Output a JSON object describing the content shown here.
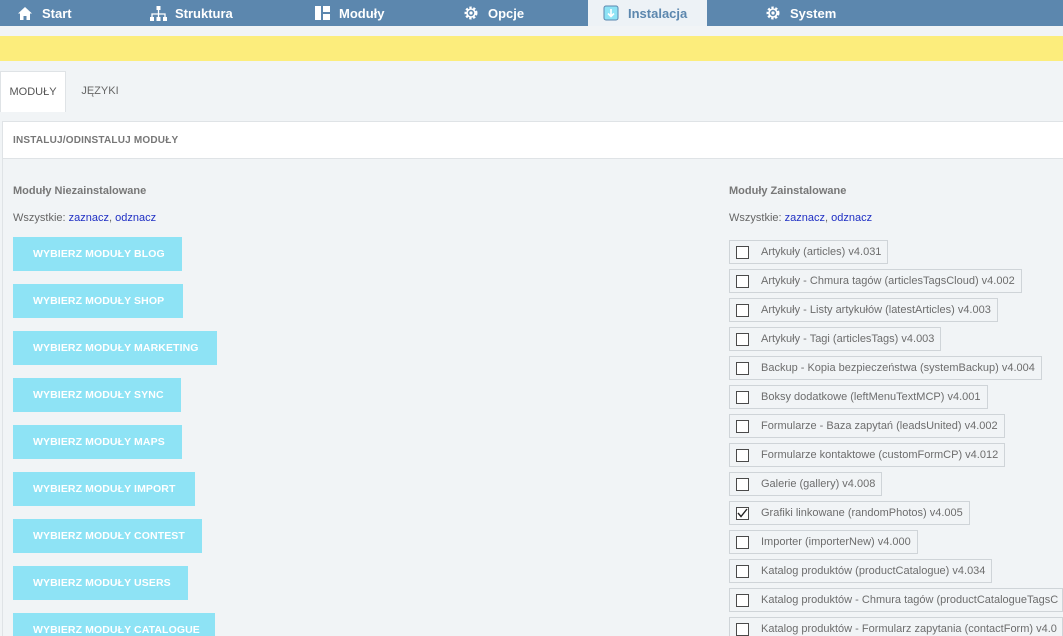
{
  "nav": [
    {
      "label": "Start",
      "icon": "home-icon"
    },
    {
      "label": "Struktura",
      "icon": "sitemap-icon"
    },
    {
      "label": "Moduły",
      "icon": "layout-icon"
    },
    {
      "label": "Opcje",
      "icon": "gear-icon"
    },
    {
      "label": "Instalacja",
      "icon": "install-icon"
    },
    {
      "label": "System",
      "icon": "gear-icon"
    }
  ],
  "tabs": [
    {
      "label": "MODUŁY"
    },
    {
      "label": "JĘZYKI"
    }
  ],
  "panel": {
    "title": "INSTALUJ/ODINSTALUJ MODUŁY"
  },
  "left": {
    "title": "Moduły Niezainstalowane",
    "all_label": "Wszystkie: ",
    "select": "zaznacz",
    "sep": ", ",
    "deselect": "odznacz",
    "buttons": [
      "WYBIERZ MODUŁY BLOG",
      "WYBIERZ MODUŁY SHOP",
      "WYBIERZ MODUŁY MARKETING",
      "WYBIERZ MODUŁY SYNC",
      "WYBIERZ MODUŁY MAPS",
      "WYBIERZ MODUŁY IMPORT",
      "WYBIERZ MODUŁY CONTEST",
      "WYBIERZ MODUŁY USERS",
      "WYBIERZ MODUŁY CATALOGUE"
    ]
  },
  "right": {
    "title": "Moduły Zainstalowane",
    "all_label": "Wszystkie: ",
    "select": "zaznacz",
    "sep": ", ",
    "deselect": "odznacz",
    "modules": [
      {
        "label": "Artykuły (articles) v4.031",
        "checked": false
      },
      {
        "label": "Artykuły - Chmura tagów (articlesTagsCloud) v4.002",
        "checked": false
      },
      {
        "label": "Artykuły - Listy artykułów (latestArticles) v4.003",
        "checked": false
      },
      {
        "label": "Artykuły - Tagi (articlesTags) v4.003",
        "checked": false
      },
      {
        "label": "Backup - Kopia bezpieczeństwa (systemBackup) v4.004",
        "checked": false
      },
      {
        "label": "Boksy dodatkowe (leftMenuTextMCP) v4.001",
        "checked": false
      },
      {
        "label": "Formularze - Baza zapytań (leadsUnited) v4.002",
        "checked": false
      },
      {
        "label": "Formularze kontaktowe (customFormCP) v4.012",
        "checked": false
      },
      {
        "label": "Galerie (gallery) v4.008",
        "checked": false
      },
      {
        "label": "Grafiki linkowane (randomPhotos) v4.005",
        "checked": true
      },
      {
        "label": "Importer (importerNew) v4.000",
        "checked": false
      },
      {
        "label": "Katalog produktów (productCatalogue) v4.034",
        "checked": false
      },
      {
        "label": "Katalog produktów - Chmura tagów (productCatalogueTagsC",
        "checked": false
      },
      {
        "label": "Katalog produktów - Formularz zapytania (contactForm) v4.0",
        "checked": false
      }
    ]
  },
  "colors": {
    "nav_bg": "#5c87ae",
    "alert_bg": "#fced7c",
    "button_bg": "#8ee3f5",
    "link": "#1f2fc4"
  }
}
